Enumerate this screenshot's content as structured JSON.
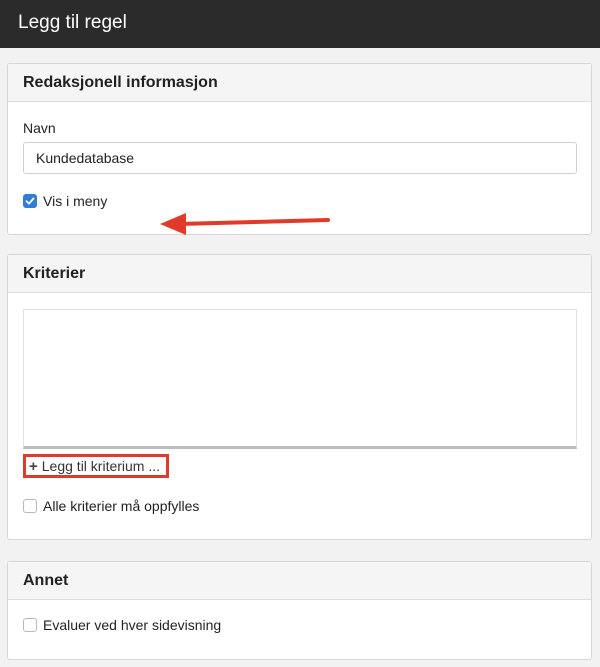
{
  "window": {
    "title": "Legg til regel"
  },
  "editorial": {
    "heading": "Redaksjonell informasjon",
    "name_label": "Navn",
    "name_value": "Kundedatabase",
    "show_in_menu_label": "Vis i meny",
    "show_in_menu_checked": true
  },
  "criteria": {
    "heading": "Kriterier",
    "add_label": "Legg til kriterium ...",
    "all_required_label": "Alle kriterier må oppfylles",
    "all_required_checked": false
  },
  "other": {
    "heading": "Annet",
    "evaluate_label": "Evaluer ved hver sidevisning",
    "evaluate_checked": false
  },
  "colors": {
    "topbar": "#2b2b2b",
    "accent_check": "#2f7dd5",
    "annotation_red": "#e03a2a"
  }
}
